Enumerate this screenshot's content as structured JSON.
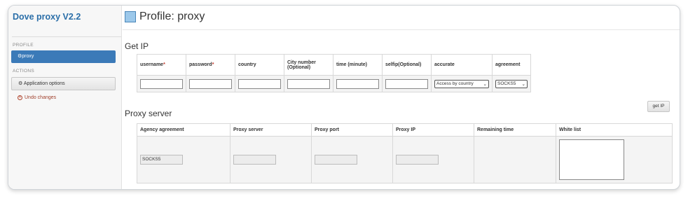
{
  "app": {
    "brand": "Dove proxy V2.2"
  },
  "sidebar": {
    "profile_header": "PROFILE",
    "active_item": "proxy",
    "actions_header": "ACTIONS",
    "options_button": "Application options",
    "undo": "Undo changes"
  },
  "page": {
    "title": "Profile: proxy"
  },
  "get_ip": {
    "section_title": "Get IP",
    "headers": {
      "username": "username",
      "password": "password",
      "country": "country",
      "city_line1": "City number",
      "city_line2": "(Optional)",
      "time": "time  (minute)",
      "selfip": "selfip(Optional)",
      "accurate": "accurate",
      "agreement": "agreement"
    },
    "required_mark": "*",
    "accurate_selected": "Access by country",
    "agreement_selected": "SOCKS5",
    "button": "get IP"
  },
  "proxy_server": {
    "section_title": "Proxy server",
    "headers": [
      "Agency agreement",
      "Proxy server",
      "Proxy port",
      "Proxy IP",
      "Remaining time",
      "White list"
    ],
    "agency_agreement_value": "SOCKS5"
  }
}
